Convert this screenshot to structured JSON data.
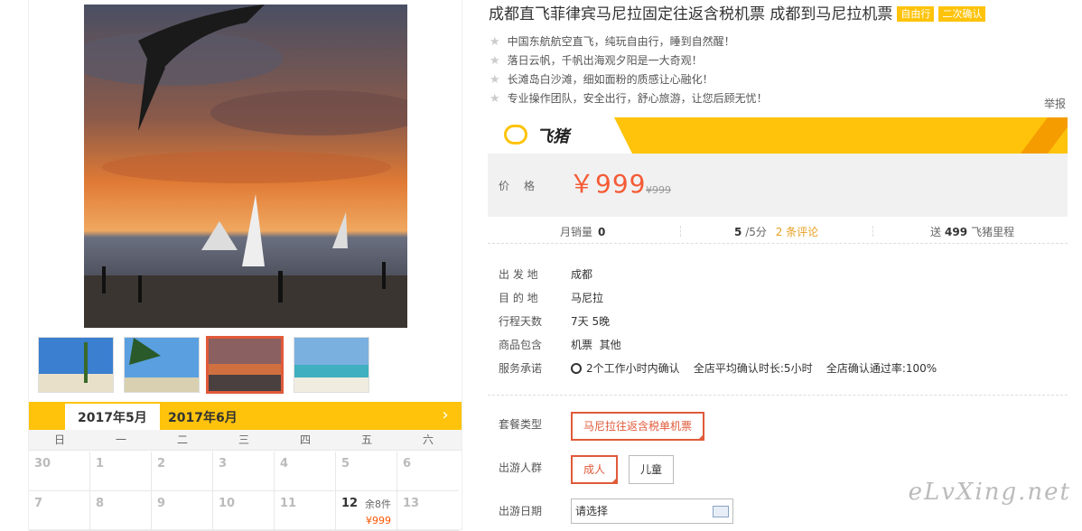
{
  "product": {
    "title": "成都直飞菲律宾马尼拉固定往返含税机票 成都到马尼拉机票",
    "tags": [
      "自由行",
      "二次确认"
    ],
    "features": [
      "中国东航航空直飞，纯玩自由行，睡到自然醒！",
      "落日云帆，千帆出海观夕阳是一大奇观！",
      "长滩岛白沙滩，细如面粉的质感让心融化！",
      "专业操作团队，安全出行，舒心旅游，让您后顾无忧！"
    ],
    "report_label": "举报"
  },
  "brand": {
    "name": "飞猪",
    "accent": "#fec30a",
    "icon": "fliggy-logo-icon"
  },
  "price": {
    "label": "价格",
    "value": "￥999",
    "original": "¥999"
  },
  "stats": {
    "monthly_sales_label": "月销量",
    "monthly_sales": "0",
    "rating": "5",
    "rating_suffix": "/5分",
    "reviews_link": "2 条评论",
    "points_prefix": "送",
    "points": "499",
    "points_suffix": "飞猪里程"
  },
  "info": [
    {
      "label": "出 发 地",
      "value": "成都"
    },
    {
      "label": "目 的 地",
      "value": "马尼拉"
    },
    {
      "label": "行程天数",
      "value": "7天 5晚"
    },
    {
      "label": "商品包含",
      "value": "机票  其他"
    },
    {
      "label": "服务承诺",
      "value": "2个工作小时内确认    全店平均确认时长:5小时    全店确认通过率:100%"
    }
  ],
  "options": {
    "package_label": "套餐类型",
    "package_value": "马尼拉往返含税单机票",
    "people_label": "出游人群",
    "people": [
      "成人",
      "儿童"
    ],
    "date_label": "出游日期",
    "date_placeholder": "请选择"
  },
  "calendar": {
    "tabs": [
      "2017年5月",
      "2017年6月"
    ],
    "weekdays": [
      "日",
      "一",
      "二",
      "三",
      "四",
      "五",
      "六"
    ],
    "row1": [
      "30",
      "1",
      "2",
      "3",
      "4",
      "5",
      "6"
    ],
    "row2": [
      "7",
      "8",
      "9",
      "10",
      "11",
      "12",
      "13"
    ],
    "avail": {
      "day": "12",
      "remaining": "余8件",
      "price": "¥999"
    }
  },
  "watermark": "eLvXing.net"
}
